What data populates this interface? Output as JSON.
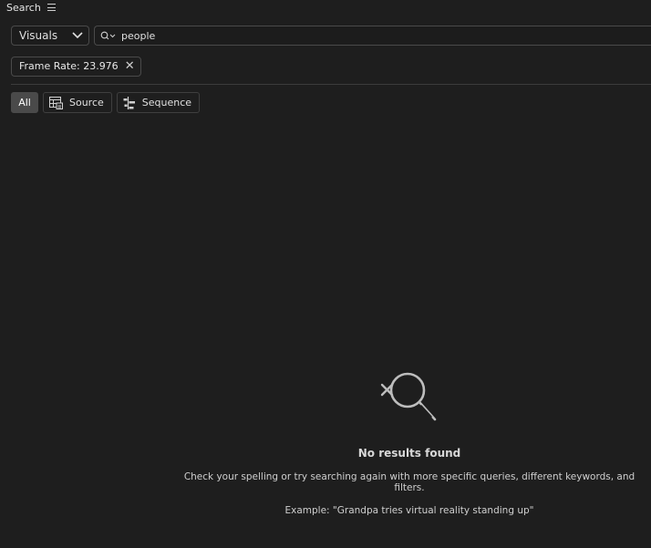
{
  "panel": {
    "title": "Search",
    "menu_icon": "hamburger-icon"
  },
  "search": {
    "scope_label": "Visuals",
    "query": "people",
    "search_icon": "search-icon"
  },
  "filters": [
    {
      "label": "Frame Rate: 23.976",
      "remove_icon": "close-icon"
    }
  ],
  "tabs": [
    {
      "label": "All",
      "active": true
    },
    {
      "label": "Source",
      "icon": "source-bin-icon"
    },
    {
      "label": "Sequence",
      "icon": "sequence-icon"
    }
  ],
  "empty_state": {
    "icon": "no-results-icon",
    "title": "No results found",
    "message": "Check your spelling or try searching again with more specific queries, different keywords, and filters.",
    "example": "Example: \"Grandpa tries virtual reality standing up\""
  }
}
